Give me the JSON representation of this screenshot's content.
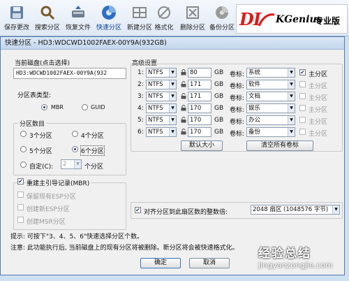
{
  "toolbar": {
    "items": [
      {
        "label": "保存更改",
        "icon": "save-icon"
      },
      {
        "label": "搜索分区",
        "icon": "search-icon"
      },
      {
        "label": "恢复文件",
        "icon": "restore-icon"
      },
      {
        "label": "快速分区",
        "icon": "quick-partition-icon"
      },
      {
        "label": "新建分区",
        "icon": "new-partition-icon"
      },
      {
        "label": "格式化",
        "icon": "format-icon"
      },
      {
        "label": "删除分区",
        "icon": "delete-icon"
      },
      {
        "label": "备份分区",
        "icon": "backup-icon"
      }
    ],
    "logo": {
      "d": "DI",
      "k": "KGenius",
      "zh": "专业版"
    }
  },
  "dialog": {
    "title": "快速分区 - HD3:WDCWD1002FAEX-00Y9A(932GB)",
    "current_disk_label": "当前磁盘(点击选择)",
    "current_disk_value": "HD3:WDCWD1002FAEX-00Y9A(932",
    "partition_type": {
      "title": "分区表类型:",
      "options": [
        {
          "label": "MBR",
          "selected": true
        },
        {
          "label": "GUID",
          "selected": false
        }
      ]
    },
    "partition_count": {
      "title": "分区数目",
      "options": [
        {
          "label": "3个分区",
          "selected": false
        },
        {
          "label": "4个分区",
          "selected": false
        },
        {
          "label": "5个分区",
          "selected": false
        },
        {
          "label": "6个分区",
          "selected": true
        }
      ],
      "custom_label": "自定(C):",
      "custom_value": "2",
      "custom_suffix": "个分区"
    },
    "options": [
      {
        "label": "重建主引导记录(MBR)",
        "checked": true,
        "enabled": true
      },
      {
        "label": "保留现有ESP分区",
        "checked": false,
        "enabled": false
      },
      {
        "label": "创建新ESP分区",
        "checked": false,
        "enabled": false
      },
      {
        "label": "创建MSR分区",
        "checked": false,
        "enabled": false
      }
    ],
    "advanced": {
      "title": "高级设置",
      "unit": "GB",
      "label_prefix": "卷标:",
      "primary_label": "主分区",
      "rows": [
        {
          "index": "1:",
          "fs": "NTFS",
          "size": "80",
          "volume": "系统",
          "primary": true
        },
        {
          "index": "2:",
          "fs": "NTFS",
          "size": "171",
          "volume": "软件",
          "primary": false
        },
        {
          "index": "3:",
          "fs": "NTFS",
          "size": "171",
          "volume": "文档",
          "primary": false
        },
        {
          "index": "4:",
          "fs": "NTFS",
          "size": "170",
          "volume": "娱乐",
          "primary": false
        },
        {
          "index": "5:",
          "fs": "NTFS",
          "size": "170",
          "volume": "办公",
          "primary": false
        },
        {
          "index": "6:",
          "fs": "NTFS",
          "size": "170",
          "volume": "备份",
          "primary": false
        }
      ],
      "default_size_button": "默认大小",
      "clear_labels_button": "清空所有卷标"
    },
    "align": {
      "label": "对齐分区到此扇区数的整数倍:",
      "checked": true,
      "value": "2048 扇区 (1048576 字节)"
    },
    "tips": {
      "line1": "提示: 可按下\"3、4、5、6\"快速选择分区个数。",
      "line2": "注意: 此功能执行后, 当前磁盘上的现有分区将被删除。新分区将会被快速格式化。"
    },
    "ok_button": "确定",
    "cancel_button": "取消"
  },
  "watermark": {
    "line1": "经验总结",
    "line2": "jingyanzongjie.com"
  }
}
